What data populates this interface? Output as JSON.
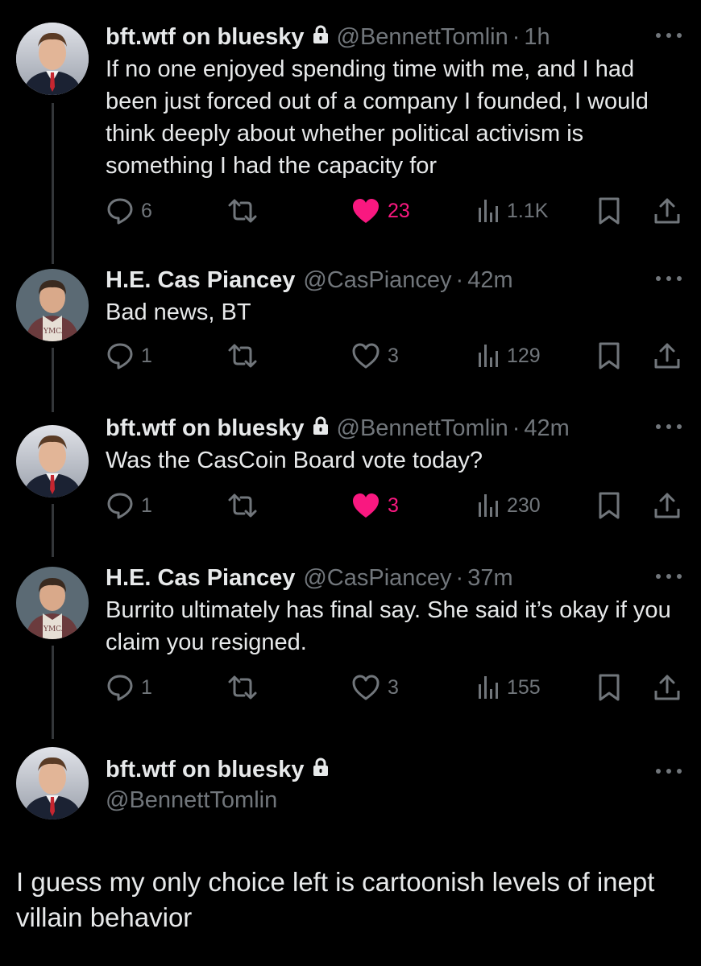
{
  "tweets": [
    {
      "name": "bft.wtf on bluesky",
      "handle": "@BennettTomlin",
      "time": "1h",
      "text": "If no one enjoyed spending time with me, and I had been just forced out of a company I founded, I would think deeply about whether political activism is something I had the capacity for",
      "replies": "6",
      "retweets": "",
      "likes": "23",
      "views": "1.1K",
      "liked": true,
      "locked": true,
      "avatar": "man-suit-avatar"
    },
    {
      "name": "H.E. Cas Piancey",
      "handle": "@CasPiancey",
      "time": "42m",
      "text": "Bad news, BT",
      "replies": "1",
      "retweets": "",
      "likes": "3",
      "views": "129",
      "liked": false,
      "locked": false,
      "avatar": "boy-jersey-avatar"
    },
    {
      "name": "bft.wtf on bluesky",
      "handle": "@BennettTomlin",
      "time": "42m",
      "text": "Was the CasCoin Board vote today?",
      "replies": "1",
      "retweets": "",
      "likes": "3",
      "views": "230",
      "liked": true,
      "locked": true,
      "avatar": "man-suit-avatar"
    },
    {
      "name": "H.E. Cas Piancey",
      "handle": "@CasPiancey",
      "time": "37m",
      "text": "Burrito ultimately has final say. She said it’s okay if you claim you resigned.",
      "replies": "1",
      "retweets": "",
      "likes": "3",
      "views": "155",
      "liked": false,
      "locked": false,
      "avatar": "boy-jersey-avatar"
    }
  ],
  "final_post": {
    "name": "bft.wtf on bluesky",
    "handle": "@BennettTomlin",
    "text": "I guess my only choice left is cartoonish levels of inept villain behavior",
    "locked": true
  },
  "colors": {
    "background": "#000000",
    "text": "#e7e9ea",
    "muted": "#71767b",
    "like": "#f91880",
    "thread_line": "#333639"
  }
}
